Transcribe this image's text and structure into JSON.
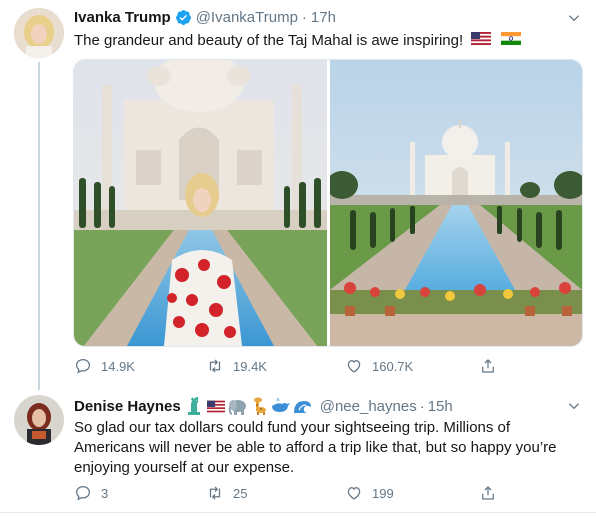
{
  "tweet": {
    "author_name": "Ivanka Trump",
    "handle": "@IvankaTrump",
    "separator": "·",
    "time": "17h",
    "text": "The grandeur and beauty of the Taj Mahal is awe inspiring!",
    "flags": [
      "us-flag-icon",
      "india-flag-icon"
    ],
    "media": [
      "ivanka-at-taj-mahal-photo",
      "taj-mahal-wide-photo"
    ],
    "actions": {
      "replies": "14.9K",
      "retweets": "19.4K",
      "likes": "160.7K"
    }
  },
  "reply": {
    "author_name": "Denise Haynes",
    "name_emojis": [
      "statue-of-liberty-icon",
      "us-flag-icon",
      "elephant-icon",
      "giraffe-icon",
      "whale-icon",
      "wave-icon"
    ],
    "handle": "@nee_haynes",
    "separator": "·",
    "time": "15h",
    "text_lines": [
      "So glad our tax dollars could fund your sightseeing trip.  Millions of",
      "Americans will never be able to afford a trip like that, but so happy you’re",
      "enjoying yourself at our expense."
    ],
    "actions": {
      "replies": "3",
      "retweets": "25",
      "likes": "199"
    }
  },
  "colors": {
    "text": "#14171a",
    "secondary": "#657786",
    "verified": "#1da1f2",
    "thread_line": "#ccd6dd",
    "divider": "#e6ecf0"
  }
}
